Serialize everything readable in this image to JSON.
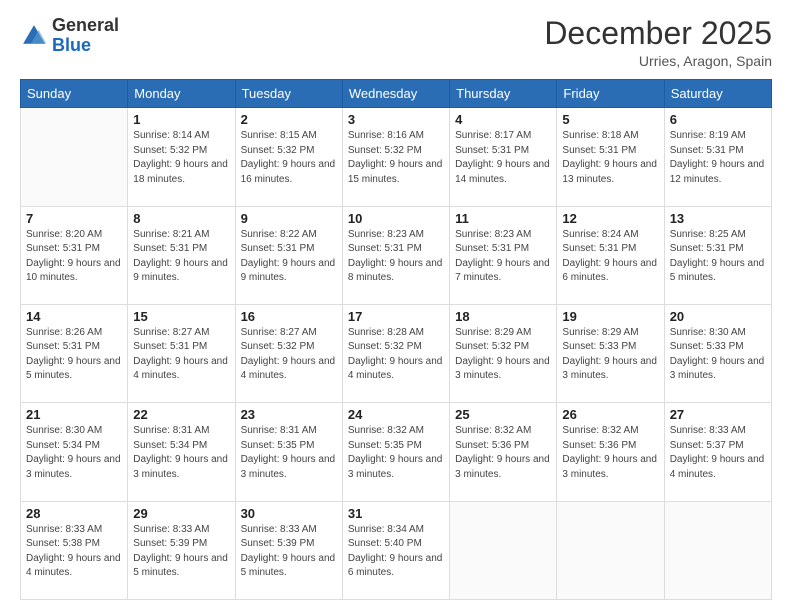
{
  "logo": {
    "general": "General",
    "blue": "Blue"
  },
  "header": {
    "month": "December 2025",
    "location": "Urries, Aragon, Spain"
  },
  "weekdays": [
    "Sunday",
    "Monday",
    "Tuesday",
    "Wednesday",
    "Thursday",
    "Friday",
    "Saturday"
  ],
  "weeks": [
    [
      {
        "day": "",
        "sunrise": "",
        "sunset": "",
        "daylight": ""
      },
      {
        "day": "1",
        "sunrise": "Sunrise: 8:14 AM",
        "sunset": "Sunset: 5:32 PM",
        "daylight": "Daylight: 9 hours and 18 minutes."
      },
      {
        "day": "2",
        "sunrise": "Sunrise: 8:15 AM",
        "sunset": "Sunset: 5:32 PM",
        "daylight": "Daylight: 9 hours and 16 minutes."
      },
      {
        "day": "3",
        "sunrise": "Sunrise: 8:16 AM",
        "sunset": "Sunset: 5:32 PM",
        "daylight": "Daylight: 9 hours and 15 minutes."
      },
      {
        "day": "4",
        "sunrise": "Sunrise: 8:17 AM",
        "sunset": "Sunset: 5:31 PM",
        "daylight": "Daylight: 9 hours and 14 minutes."
      },
      {
        "day": "5",
        "sunrise": "Sunrise: 8:18 AM",
        "sunset": "Sunset: 5:31 PM",
        "daylight": "Daylight: 9 hours and 13 minutes."
      },
      {
        "day": "6",
        "sunrise": "Sunrise: 8:19 AM",
        "sunset": "Sunset: 5:31 PM",
        "daylight": "Daylight: 9 hours and 12 minutes."
      }
    ],
    [
      {
        "day": "7",
        "sunrise": "Sunrise: 8:20 AM",
        "sunset": "Sunset: 5:31 PM",
        "daylight": "Daylight: 9 hours and 10 minutes."
      },
      {
        "day": "8",
        "sunrise": "Sunrise: 8:21 AM",
        "sunset": "Sunset: 5:31 PM",
        "daylight": "Daylight: 9 hours and 9 minutes."
      },
      {
        "day": "9",
        "sunrise": "Sunrise: 8:22 AM",
        "sunset": "Sunset: 5:31 PM",
        "daylight": "Daylight: 9 hours and 9 minutes."
      },
      {
        "day": "10",
        "sunrise": "Sunrise: 8:23 AM",
        "sunset": "Sunset: 5:31 PM",
        "daylight": "Daylight: 9 hours and 8 minutes."
      },
      {
        "day": "11",
        "sunrise": "Sunrise: 8:23 AM",
        "sunset": "Sunset: 5:31 PM",
        "daylight": "Daylight: 9 hours and 7 minutes."
      },
      {
        "day": "12",
        "sunrise": "Sunrise: 8:24 AM",
        "sunset": "Sunset: 5:31 PM",
        "daylight": "Daylight: 9 hours and 6 minutes."
      },
      {
        "day": "13",
        "sunrise": "Sunrise: 8:25 AM",
        "sunset": "Sunset: 5:31 PM",
        "daylight": "Daylight: 9 hours and 5 minutes."
      }
    ],
    [
      {
        "day": "14",
        "sunrise": "Sunrise: 8:26 AM",
        "sunset": "Sunset: 5:31 PM",
        "daylight": "Daylight: 9 hours and 5 minutes."
      },
      {
        "day": "15",
        "sunrise": "Sunrise: 8:27 AM",
        "sunset": "Sunset: 5:31 PM",
        "daylight": "Daylight: 9 hours and 4 minutes."
      },
      {
        "day": "16",
        "sunrise": "Sunrise: 8:27 AM",
        "sunset": "Sunset: 5:32 PM",
        "daylight": "Daylight: 9 hours and 4 minutes."
      },
      {
        "day": "17",
        "sunrise": "Sunrise: 8:28 AM",
        "sunset": "Sunset: 5:32 PM",
        "daylight": "Daylight: 9 hours and 4 minutes."
      },
      {
        "day": "18",
        "sunrise": "Sunrise: 8:29 AM",
        "sunset": "Sunset: 5:32 PM",
        "daylight": "Daylight: 9 hours and 3 minutes."
      },
      {
        "day": "19",
        "sunrise": "Sunrise: 8:29 AM",
        "sunset": "Sunset: 5:33 PM",
        "daylight": "Daylight: 9 hours and 3 minutes."
      },
      {
        "day": "20",
        "sunrise": "Sunrise: 8:30 AM",
        "sunset": "Sunset: 5:33 PM",
        "daylight": "Daylight: 9 hours and 3 minutes."
      }
    ],
    [
      {
        "day": "21",
        "sunrise": "Sunrise: 8:30 AM",
        "sunset": "Sunset: 5:34 PM",
        "daylight": "Daylight: 9 hours and 3 minutes."
      },
      {
        "day": "22",
        "sunrise": "Sunrise: 8:31 AM",
        "sunset": "Sunset: 5:34 PM",
        "daylight": "Daylight: 9 hours and 3 minutes."
      },
      {
        "day": "23",
        "sunrise": "Sunrise: 8:31 AM",
        "sunset": "Sunset: 5:35 PM",
        "daylight": "Daylight: 9 hours and 3 minutes."
      },
      {
        "day": "24",
        "sunrise": "Sunrise: 8:32 AM",
        "sunset": "Sunset: 5:35 PM",
        "daylight": "Daylight: 9 hours and 3 minutes."
      },
      {
        "day": "25",
        "sunrise": "Sunrise: 8:32 AM",
        "sunset": "Sunset: 5:36 PM",
        "daylight": "Daylight: 9 hours and 3 minutes."
      },
      {
        "day": "26",
        "sunrise": "Sunrise: 8:32 AM",
        "sunset": "Sunset: 5:36 PM",
        "daylight": "Daylight: 9 hours and 3 minutes."
      },
      {
        "day": "27",
        "sunrise": "Sunrise: 8:33 AM",
        "sunset": "Sunset: 5:37 PM",
        "daylight": "Daylight: 9 hours and 4 minutes."
      }
    ],
    [
      {
        "day": "28",
        "sunrise": "Sunrise: 8:33 AM",
        "sunset": "Sunset: 5:38 PM",
        "daylight": "Daylight: 9 hours and 4 minutes."
      },
      {
        "day": "29",
        "sunrise": "Sunrise: 8:33 AM",
        "sunset": "Sunset: 5:39 PM",
        "daylight": "Daylight: 9 hours and 5 minutes."
      },
      {
        "day": "30",
        "sunrise": "Sunrise: 8:33 AM",
        "sunset": "Sunset: 5:39 PM",
        "daylight": "Daylight: 9 hours and 5 minutes."
      },
      {
        "day": "31",
        "sunrise": "Sunrise: 8:34 AM",
        "sunset": "Sunset: 5:40 PM",
        "daylight": "Daylight: 9 hours and 6 minutes."
      },
      {
        "day": "",
        "sunrise": "",
        "sunset": "",
        "daylight": ""
      },
      {
        "day": "",
        "sunrise": "",
        "sunset": "",
        "daylight": ""
      },
      {
        "day": "",
        "sunrise": "",
        "sunset": "",
        "daylight": ""
      }
    ]
  ]
}
